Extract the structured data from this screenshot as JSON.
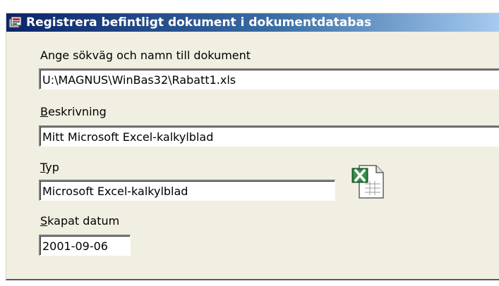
{
  "window": {
    "title": "Registrera befintligt dokument i dokumentdatabas"
  },
  "form": {
    "path_label": "Ange sökväg och namn till dokument",
    "path_value": "U:\\MAGNUS\\WinBas32\\Rabatt1.xls",
    "description_label_first": "B",
    "description_label_rest": "eskrivning",
    "description_value": "Mitt Microsoft Excel-kalkylblad",
    "type_label_first": "T",
    "type_label_rest": "yp",
    "type_value": "Microsoft Excel-kalkylblad",
    "created_label_first": "S",
    "created_label_rest": "kapat datum",
    "created_value": "2001-09-06"
  },
  "icons": {
    "app": "app-icon",
    "document_type": "excel-document-icon"
  }
}
